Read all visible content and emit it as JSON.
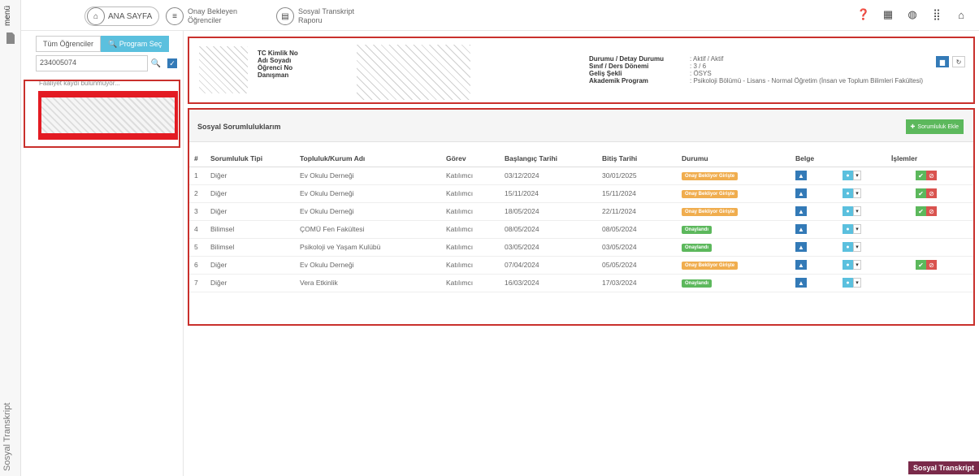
{
  "sidebar": {
    "menu_label": "menü",
    "vertical_title": "Sosyal Transkript"
  },
  "topnav": {
    "home_label": "ANA SAYFA",
    "pending_line1": "Onay Bekleyen",
    "pending_line2": "Öğrenciler",
    "report_line1": "Sosyal Transkript",
    "report_line2": "Raporu",
    "right_icons": [
      "help-icon",
      "calendar-icon",
      "globe-icon",
      "grid-icon",
      "lock-icon"
    ]
  },
  "students": {
    "tab_all": "Tüm Öğrenciler",
    "tab_program": "Program Seç",
    "search_value": "234005074",
    "loading_text": "Faaliyet kaydı bulunmuyor..."
  },
  "student_info": {
    "labels": [
      "TC Kimlik No",
      "Adı Soyadı",
      "Öğrenci No",
      "Danışman"
    ],
    "labels2": [
      "Durumu / Detay Durumu",
      "Sınıf / Ders Dönemi",
      "Geliş Şekli",
      "Akademik Program"
    ],
    "values2": [
      ": Aktif / Aktif",
      ": 3 / 6",
      ": ÖSYS",
      ": Psikoloji Bölümü - Lisans - Normal Öğretim (İnsan ve Toplum Bilimleri Fakültesi)"
    ]
  },
  "responsibilities": {
    "title": "Sosyal Sorumluluklarım",
    "add_label": "Sorumluluk Ekle",
    "columns": [
      "#",
      "Sorumluluk Tipi",
      "Topluluk/Kurum Adı",
      "Görev",
      "Başlangıç Tarihi",
      "Bitiş Tarihi",
      "Durumu",
      "Belge",
      "",
      "İşlemler"
    ],
    "rows": [
      {
        "no": "1",
        "type": "Diğer",
        "org": "Ev Okulu Derneği",
        "role": "Katılımcı",
        "start": "03/12/2024",
        "end": "30/01/2025",
        "status": "Onay Bekliyor Girişte",
        "status_color": "#f0ad4e",
        "actions": true
      },
      {
        "no": "2",
        "type": "Diğer",
        "org": "Ev Okulu Derneği",
        "role": "Katılımcı",
        "start": "15/11/2024",
        "end": "15/11/2024",
        "status": "Onay Bekliyor Girişte",
        "status_color": "#f0ad4e",
        "actions": true
      },
      {
        "no": "3",
        "type": "Diğer",
        "org": "Ev Okulu Derneği",
        "role": "Katılımcı",
        "start": "18/05/2024",
        "end": "22/11/2024",
        "status": "Onay Bekliyor Girişte",
        "status_color": "#f0ad4e",
        "actions": true
      },
      {
        "no": "4",
        "type": "Bilimsel",
        "org": "ÇOMÜ Fen Fakültesi",
        "role": "Katılımcı",
        "start": "08/05/2024",
        "end": "08/05/2024",
        "status": "Onaylandı",
        "status_color": "#5cb85c",
        "actions": false
      },
      {
        "no": "5",
        "type": "Bilimsel",
        "org": "Psikoloji ve Yaşam Kulübü",
        "role": "Katılımcı",
        "start": "03/05/2024",
        "end": "03/05/2024",
        "status": "Onaylandı",
        "status_color": "#5cb85c",
        "actions": false
      },
      {
        "no": "6",
        "type": "Diğer",
        "org": "Ev Okulu Derneği",
        "role": "Katılımcı",
        "start": "07/04/2024",
        "end": "05/05/2024",
        "status": "Onay Bekliyor Girişte",
        "status_color": "#f0ad4e",
        "actions": true
      },
      {
        "no": "7",
        "type": "Diğer",
        "org": "Vera Etkinlik",
        "role": "Katılımcı",
        "start": "16/03/2024",
        "end": "17/03/2024",
        "status": "Onaylandı",
        "status_color": "#5cb85c",
        "actions": false
      }
    ]
  },
  "footer_tag": "Sosyal Transkript"
}
